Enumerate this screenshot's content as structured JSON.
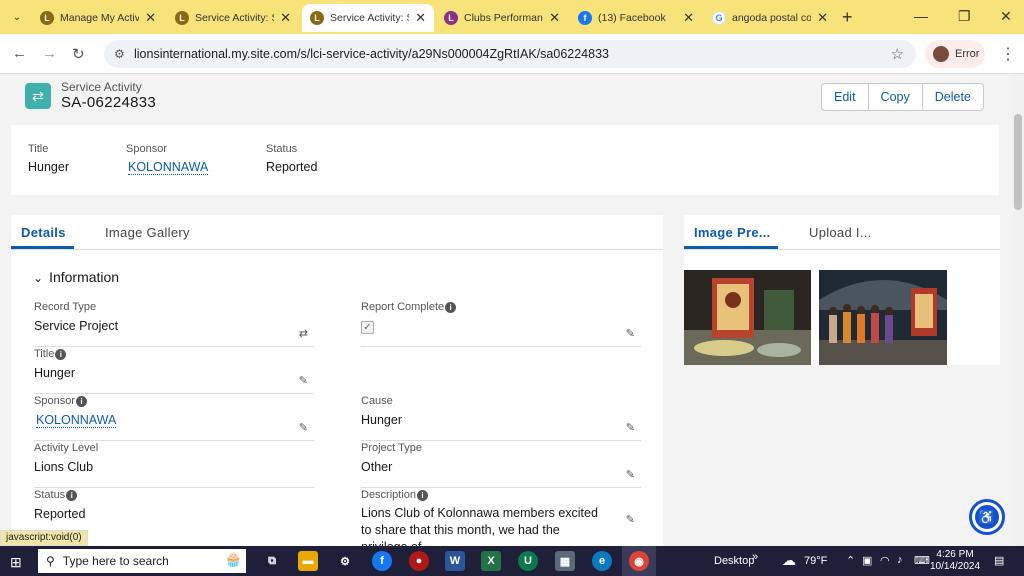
{
  "browser": {
    "tabs": [
      {
        "label": "Manage My Activi",
        "active": false,
        "favicon": "lions-icon",
        "color": "#8b6914"
      },
      {
        "label": "Service Activity: S",
        "active": false,
        "favicon": "lions-icon",
        "color": "#8b6914"
      },
      {
        "label": "Service Activity: S",
        "active": true,
        "favicon": "lions-icon",
        "color": "#8b6914"
      },
      {
        "label": "Clubs Performanc",
        "active": false,
        "favicon": "lions-icon",
        "color": "#8b2f8b"
      },
      {
        "label": "(13) Facebook",
        "active": false,
        "favicon": "facebook-icon",
        "color": "#1877f2"
      },
      {
        "label": "angoda postal co",
        "active": false,
        "favicon": "google-icon",
        "color": "#4285f4"
      }
    ],
    "url": "lionsinternational.my.site.com/s/lci-service-activity/a29Ns000004ZgRtIAK/sa06224833",
    "profile_label": "Error",
    "status_text": "javascript:void(0)"
  },
  "record": {
    "type_label": "Service Activity",
    "name": "SA-06224833",
    "actions": [
      "Edit",
      "Copy",
      "Delete"
    ]
  },
  "highlights": [
    {
      "label": "Title",
      "value": "Hunger",
      "link": false
    },
    {
      "label": "Sponsor",
      "value": "KOLONNAWA",
      "link": true
    },
    {
      "label": "Status",
      "value": "Reported",
      "link": false
    }
  ],
  "tabs": {
    "details": "Details",
    "gallery": "Image Gallery"
  },
  "section_title": "Information",
  "fields": {
    "record_type": {
      "label": "Record Type",
      "value": "Service Project"
    },
    "report_complete": {
      "label": "Report Complete",
      "value": "✓"
    },
    "title": {
      "label": "Title",
      "value": "Hunger"
    },
    "sponsor": {
      "label": "Sponsor",
      "value": "KOLONNAWA"
    },
    "cause": {
      "label": "Cause",
      "value": "Hunger"
    },
    "activity_level": {
      "label": "Activity Level",
      "value": "Lions Club"
    },
    "project_type": {
      "label": "Project Type",
      "value": "Other"
    },
    "status": {
      "label": "Status",
      "value": "Reported"
    },
    "description": {
      "label": "Description",
      "value": "Lions Club of Kolonnawa members excited to share that this month, we had the privilege of"
    }
  },
  "gallery": {
    "tab_preview": "Image Pre...",
    "tab_upload": "Upload I..."
  },
  "taskbar": {
    "search_placeholder": "Type here to search",
    "desktop_label": "Desktop",
    "weather": "79°F",
    "time": "4:26 PM",
    "date": "10/14/2024"
  },
  "colors": {
    "accent": "#0b5cab",
    "tabstrip": "#f8e27a",
    "record_icon": "#3fb0ac"
  }
}
